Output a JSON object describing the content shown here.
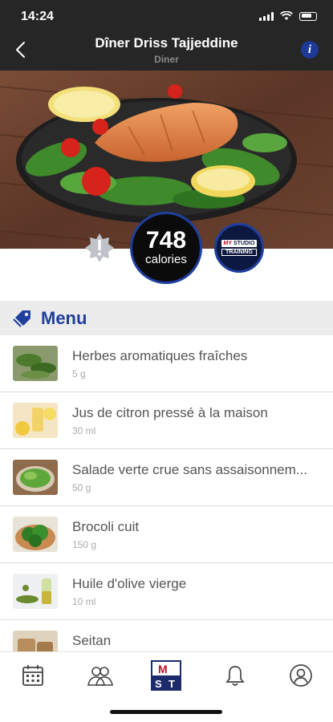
{
  "status_bar": {
    "time": "14:24"
  },
  "header": {
    "title": "Dîner Driss Tajjeddine",
    "subtitle": "Diner"
  },
  "calories": {
    "value": "748",
    "unit": "calories"
  },
  "logo": {
    "line1_brand": "MY",
    "line1": "STUDIO",
    "line2": "TRAINING"
  },
  "menu": {
    "title": "Menu",
    "items": [
      {
        "name": "Herbes aromatiques fraîches",
        "quantity": "5 g",
        "icon": "herbs-thumbnail"
      },
      {
        "name": "Jus de citron pressé à la maison",
        "quantity": "30 ml",
        "icon": "lemon-juice-thumbnail"
      },
      {
        "name": "Salade verte crue sans assaisonnem...",
        "quantity": "50 g",
        "icon": "salad-thumbnail"
      },
      {
        "name": "Brocoli cuit",
        "quantity": "150 g",
        "icon": "broccoli-thumbnail"
      },
      {
        "name": "Huile d'olive vierge",
        "quantity": "10 ml",
        "icon": "olive-oil-thumbnail"
      },
      {
        "name": "Seitan",
        "quantity": "",
        "icon": "seitan-thumbnail"
      }
    ]
  },
  "tabbar": {
    "tabs": [
      {
        "icon": "calendar-icon"
      },
      {
        "icon": "community-icon"
      },
      {
        "icon": "mst-logo-icon",
        "logo_text": "MST"
      },
      {
        "icon": "bell-icon"
      },
      {
        "icon": "profile-icon"
      }
    ]
  },
  "colors": {
    "accent": "#1f3f9e",
    "header_bg": "#262626",
    "section_bg": "#ececec"
  }
}
